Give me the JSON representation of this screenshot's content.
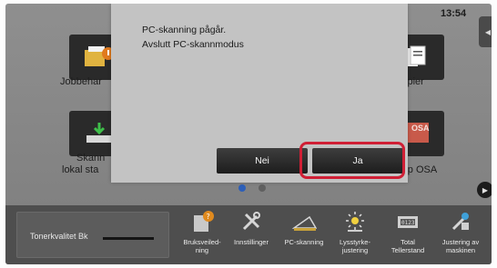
{
  "clock": "13:54",
  "home": {
    "tiles": [
      {
        "name": "job-status",
        "label": "Jobbehar"
      },
      {
        "name": "copy",
        "label": "Kopier"
      },
      {
        "name": "scan-local",
        "label_line1": "Skann",
        "label_line2": "lokal sta"
      },
      {
        "name": "sharp-osa",
        "label": "arp OSA"
      }
    ],
    "osa_badge": "OSA"
  },
  "dialog": {
    "message_line1": "PC-skanning pågår.",
    "message_line2": "Avslutt PC-skannmodus",
    "no_label": "Nei",
    "yes_label": "Ja"
  },
  "bottom_bar": {
    "toner_label": "Tonerkvalitet  Bk",
    "items": [
      {
        "name": "user-guide",
        "label": "Bruksveiled-\nning"
      },
      {
        "name": "settings",
        "label": "Innstillinger"
      },
      {
        "name": "pc-scan",
        "label": "PC-skanning"
      },
      {
        "name": "brightness",
        "label": "Lysstyrke-\njustering"
      },
      {
        "name": "total-count",
        "label": "Total\nTellerstand"
      },
      {
        "name": "machine-adjust",
        "label": "Justering av\nmaskinen"
      }
    ]
  },
  "colors": {
    "highlight": "#d01f35",
    "page_dot_active": "#2d5fb8"
  }
}
